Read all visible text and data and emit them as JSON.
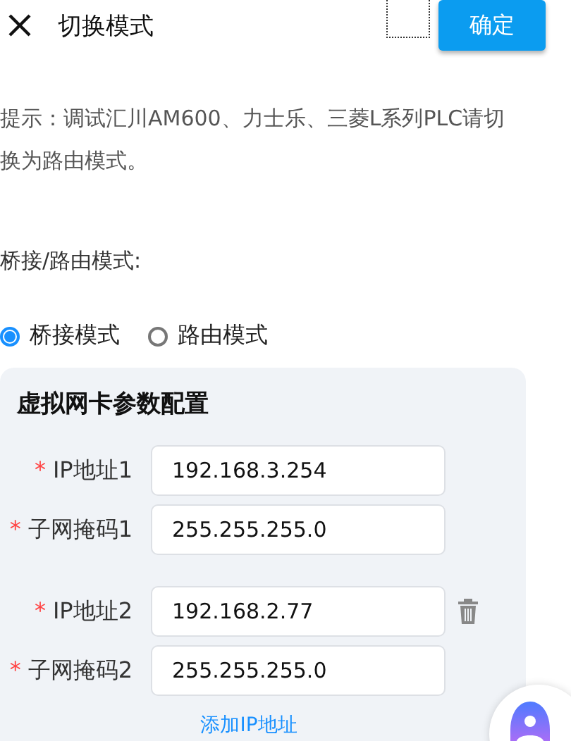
{
  "header": {
    "title": "切换模式",
    "confirm": "确定"
  },
  "hint": "提示：调试汇川AM600、力士乐、三菱L系列PLC请切换为路由模式。",
  "mode_label": "桥接/路由模式:",
  "modes": [
    {
      "label": "桥接模式",
      "selected": true
    },
    {
      "label": "路由模式",
      "selected": false
    }
  ],
  "card": {
    "title": "虚拟网卡参数配置",
    "groups": [
      {
        "removable": false,
        "fields": [
          {
            "required_mark": "*",
            "label": "IP地址1",
            "value": "192.168.3.254"
          },
          {
            "required_mark": "*",
            "label": "子网掩码1",
            "value": "255.255.255.0"
          }
        ]
      },
      {
        "removable": true,
        "fields": [
          {
            "required_mark": "*",
            "label": "IP地址2",
            "value": "192.168.2.77"
          },
          {
            "required_mark": "*",
            "label": "子网掩码2",
            "value": "255.255.255.0"
          }
        ]
      }
    ],
    "add_link": "添加IP地址"
  }
}
